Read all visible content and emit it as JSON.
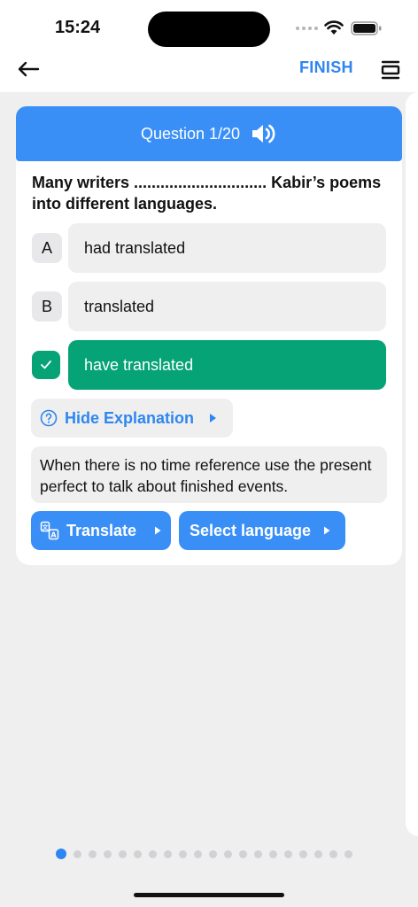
{
  "status": {
    "time": "15:24"
  },
  "nav": {
    "finish_label": "FINISH"
  },
  "question": {
    "counter": "Question 1/20",
    "text": "Many writers .............................. Kabir’s poems into different languages."
  },
  "options": [
    {
      "letter": "A",
      "text": "had translated",
      "correct": false
    },
    {
      "letter": "B",
      "text": "translated",
      "correct": false
    },
    {
      "letter": "",
      "text": "have translated",
      "correct": true
    }
  ],
  "explanation": {
    "toggle_label": "Hide Explanation",
    "text": "When there is no time reference use the present perfect to talk about finished events."
  },
  "actions": {
    "translate_label": "Translate",
    "language_label": "Select language"
  },
  "pager": {
    "total": 20,
    "current": 1
  },
  "icons": {
    "back": "arrow-left-icon",
    "list": "stack-icon",
    "speaker": "speaker-icon",
    "check": "check-icon",
    "help": "question-circle-icon",
    "translate": "translate-icon",
    "caret": "caret-right-icon"
  },
  "colors": {
    "accent": "#3a8ff7",
    "link": "#2e86f0",
    "correct": "#06a377",
    "card": "#ffffff",
    "background": "#efefef"
  }
}
